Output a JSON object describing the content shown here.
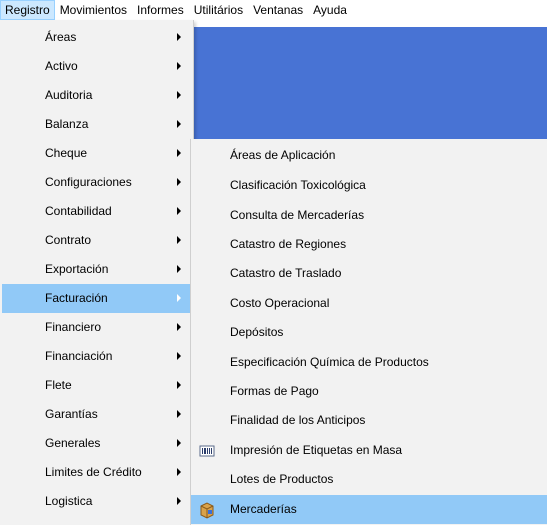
{
  "menubar": [
    "Registro",
    "Movimientos",
    "Informes",
    "Utilitários",
    "Ventanas",
    "Ayuda"
  ],
  "menu_registro": [
    {
      "label": "Áreas",
      "submenu": true
    },
    {
      "label": "Activo",
      "submenu": true
    },
    {
      "label": "Auditoria",
      "submenu": true
    },
    {
      "label": "Balanza",
      "submenu": true
    },
    {
      "label": "Cheque",
      "submenu": true
    },
    {
      "label": "Configuraciones",
      "submenu": true
    },
    {
      "label": "Contabilidad",
      "submenu": true
    },
    {
      "label": "Contrato",
      "submenu": true
    },
    {
      "label": "Exportación",
      "submenu": true
    },
    {
      "label": "Facturación",
      "submenu": true,
      "highlighted": true
    },
    {
      "label": "Financiero",
      "submenu": true
    },
    {
      "label": "Financiación",
      "submenu": true
    },
    {
      "label": "Flete",
      "submenu": true
    },
    {
      "label": "Garantías",
      "submenu": true
    },
    {
      "label": "Generales",
      "submenu": true
    },
    {
      "label": "Limites de Crédito",
      "submenu": true
    },
    {
      "label": "Logistica",
      "submenu": true
    }
  ],
  "menu_facturacion": [
    {
      "label": "Áreas de Aplicación"
    },
    {
      "label": "Clasificación Toxicológica"
    },
    {
      "label": "Consulta de Mercaderías"
    },
    {
      "label": "Catastro de Regiones"
    },
    {
      "label": "Catastro de Traslado"
    },
    {
      "label": "Costo Operacional"
    },
    {
      "label": "Depósitos"
    },
    {
      "label": "Especificación Química de Productos"
    },
    {
      "label": "Formas de Pago"
    },
    {
      "label": "Finalidad de los Anticipos"
    },
    {
      "label": "Impresión de Etiquetas en Masa",
      "icon": "barcode-icon"
    },
    {
      "label": "Lotes de Productos"
    },
    {
      "label": "Mercaderías",
      "icon": "package-icon",
      "highlighted": true
    }
  ],
  "colors": {
    "menu_bg": "#f2f2f2",
    "highlight": "#91c9f7",
    "menubar_open": "#cce8ff",
    "app_blue": "#4873d4"
  }
}
